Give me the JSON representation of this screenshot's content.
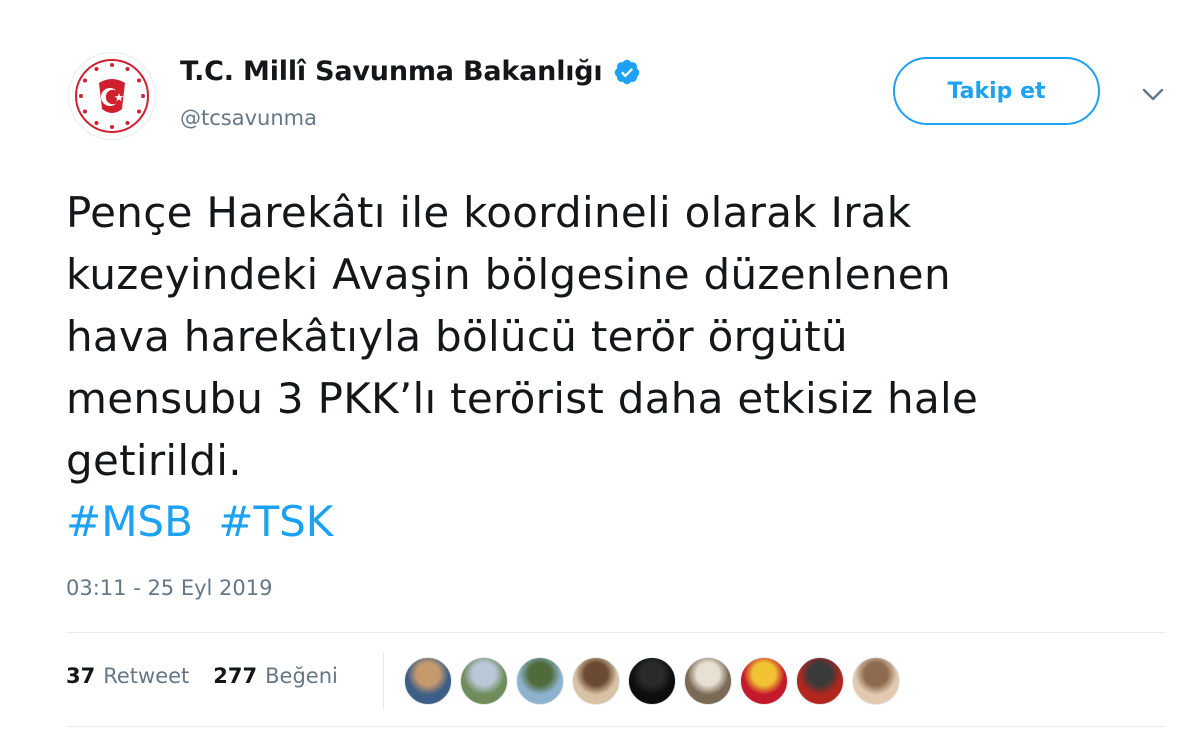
{
  "account": {
    "display_name": "T.C. Millî Savunma Bakanlığı",
    "handle": "@tcsavunma",
    "avatar_icon": "ministry-emblem-icon",
    "verified_icon": "verified-badge-icon"
  },
  "actions": {
    "follow_label": "Takip et",
    "more_icon": "chevron-down-icon"
  },
  "tweet": {
    "lines": [
      "Pençe Harekâtı ile koordineli olarak Irak",
      "kuzeyindeki Avaşin bölgesine düzenlenen",
      "hava harekâtıyla bölücü terör örgütü",
      "mensubu 3 PKK’lı terörist daha etkisiz hale",
      "getirildi."
    ],
    "hashtags": [
      "#MSB",
      "#TSK"
    ],
    "timestamp": "03:11 - 25 Eyl 2019"
  },
  "stats": {
    "retweets": {
      "count": "37",
      "label": "Retweet"
    },
    "likes": {
      "count": "277",
      "label": "Beğeni"
    }
  },
  "liker_avatars": [
    {
      "name": "liker-avatar-1",
      "colors": [
        "#3d5e86",
        "#c49a6c"
      ]
    },
    {
      "name": "liker-avatar-2",
      "colors": [
        "#6f8c5a",
        "#b9c7d8"
      ]
    },
    {
      "name": "liker-avatar-3",
      "colors": [
        "#8fb3cf",
        "#4f6b3a"
      ]
    },
    {
      "name": "liker-avatar-4",
      "colors": [
        "#d8c2a3",
        "#6b4a33"
      ]
    },
    {
      "name": "liker-avatar-5",
      "colors": [
        "#0d0d0d",
        "#2a2a2a"
      ]
    },
    {
      "name": "liker-avatar-6",
      "colors": [
        "#7a6a55",
        "#e8e0d2"
      ]
    },
    {
      "name": "liker-avatar-7",
      "colors": [
        "#c4182c",
        "#f1c232"
      ]
    },
    {
      "name": "liker-avatar-8",
      "colors": [
        "#b3261e",
        "#3a3a3a"
      ]
    },
    {
      "name": "liker-avatar-9",
      "colors": [
        "#e2c9b0",
        "#8c6b4f"
      ]
    }
  ],
  "colors": {
    "accent": "#1da1f2",
    "text": "#14171a",
    "muted": "#657786",
    "emblem_red": "#d0202e"
  }
}
